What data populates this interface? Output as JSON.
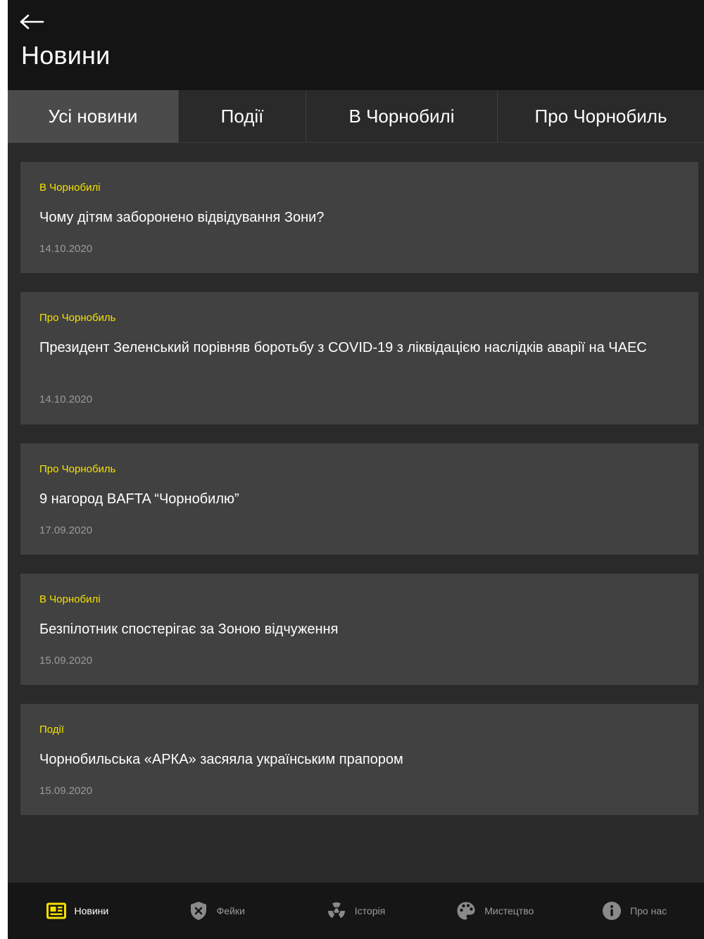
{
  "header": {
    "title": "Новини"
  },
  "tabs": [
    {
      "label": "Усі новини",
      "active": true
    },
    {
      "label": "Події",
      "active": false
    },
    {
      "label": "В Чорнобилі",
      "active": false
    },
    {
      "label": "Про Чорнобиль",
      "active": false
    }
  ],
  "news": [
    {
      "category": "В Чорнобилі",
      "title": "Чому дітям заборонено відвідування Зони?",
      "date": "14.10.2020"
    },
    {
      "category": "Про Чорнобиль",
      "title": "Президент Зеленський порівняв боротьбу з COVID-19 з ліквідацією наслідків аварії на ЧАЕС",
      "date": "14.10.2020"
    },
    {
      "category": "Про Чорнобиль",
      "title": "9 нагород BAFTA “Чорнобилю”",
      "date": "17.09.2020"
    },
    {
      "category": "В Чорнобилі",
      "title": "Безпілотник спостерігає за Зоною відчуження",
      "date": "15.09.2020"
    },
    {
      "category": "Події",
      "title": "Чорнобильська «АРКА» засяяла українським прапором",
      "date": "15.09.2020"
    }
  ],
  "bottom_nav": [
    {
      "label": "Новини",
      "icon": "newspaper-icon",
      "active": true
    },
    {
      "label": "Фейки",
      "icon": "shield-x-icon",
      "active": false
    },
    {
      "label": "Історія",
      "icon": "radiation-icon",
      "active": false
    },
    {
      "label": "Мистецтво",
      "icon": "palette-icon",
      "active": false
    },
    {
      "label": "Про нас",
      "icon": "info-icon",
      "active": false
    }
  ],
  "colors": {
    "accent": "#f5e000",
    "background": "#2a2a2a",
    "card": "#414141",
    "header": "#141414"
  }
}
